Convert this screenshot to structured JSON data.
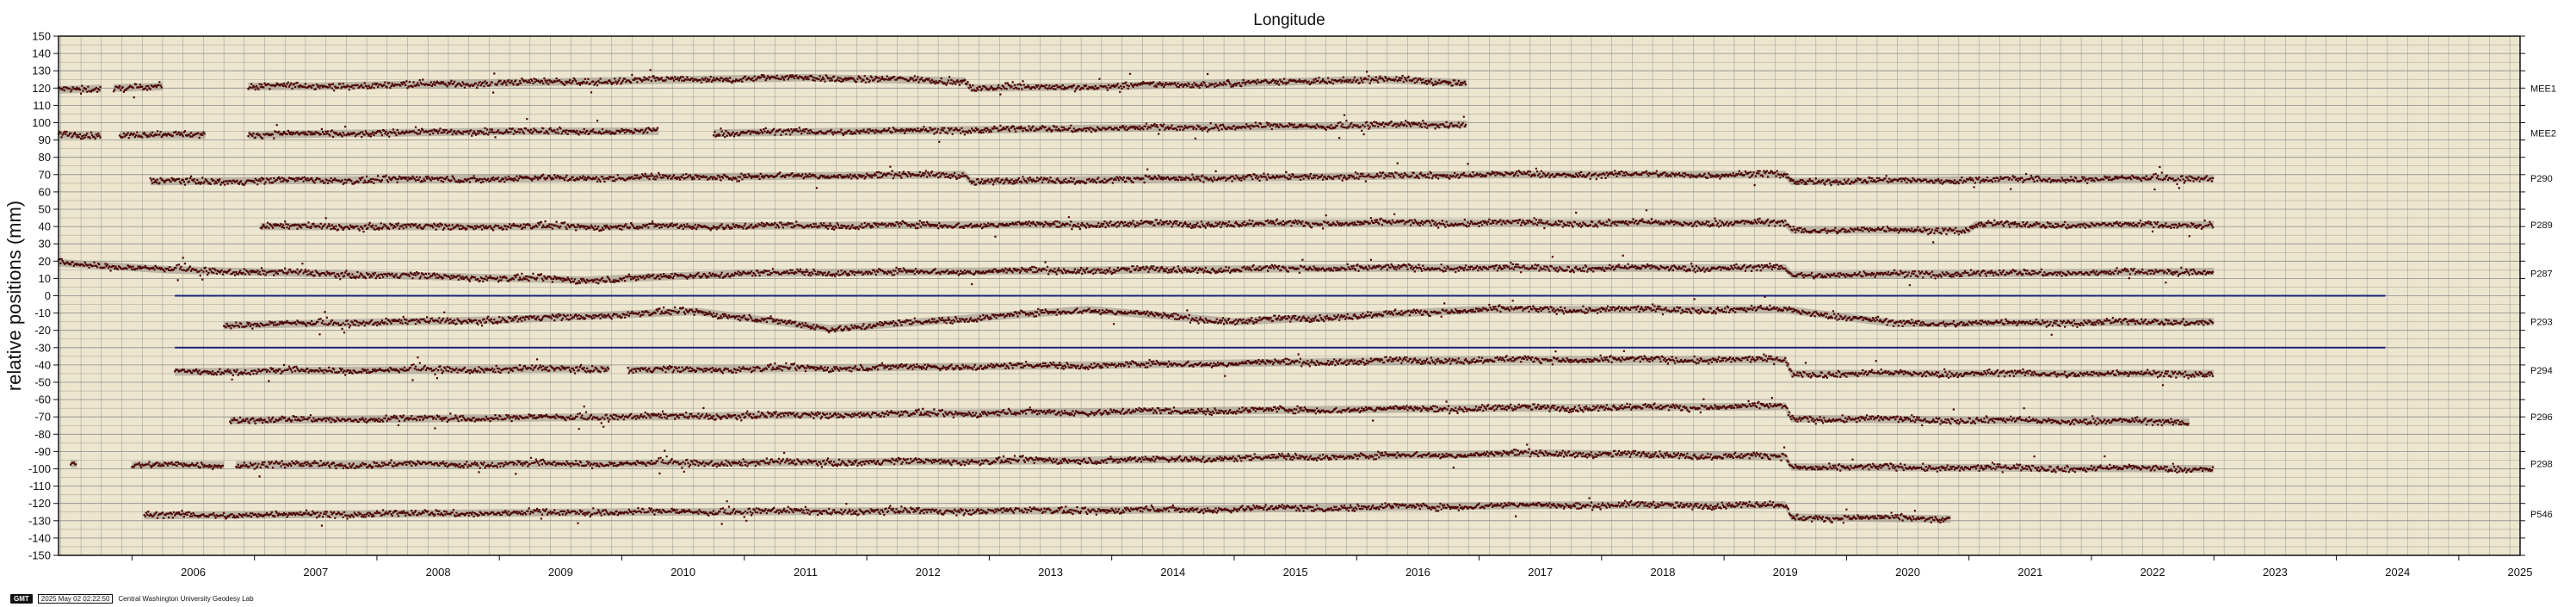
{
  "chart_data": {
    "type": "scatter",
    "title": "Longitude",
    "ylabel": "relative positions (mm)",
    "xlabel": "",
    "xlim": [
      2005.4,
      2025.5
    ],
    "ylim": [
      -150,
      150
    ],
    "grid": true,
    "x_ticks": [
      "2006",
      "2007",
      "2008",
      "2009",
      "2010",
      "2011",
      "2012",
      "2013",
      "2014",
      "2015",
      "2016",
      "2017",
      "2018",
      "2019",
      "2020",
      "2021",
      "2022",
      "2023",
      "2024",
      "2025"
    ],
    "y_ticks": [
      150,
      140,
      130,
      120,
      110,
      100,
      90,
      80,
      70,
      60,
      50,
      40,
      30,
      20,
      10,
      0,
      -10,
      -20,
      -30,
      -40,
      -50,
      -60,
      -70,
      -80,
      -90,
      -100,
      -110,
      -120,
      -130,
      -140,
      -150
    ],
    "series": [
      {
        "name": "MEE1",
        "offset": 120,
        "segments": [
          [
            2005.4,
            2005.75
          ],
          [
            2005.85,
            2006.25
          ],
          [
            2006.95,
            2016.9
          ]
        ],
        "trend": [
          [
            2005.4,
            119
          ],
          [
            2006.3,
            121
          ],
          [
            2007.5,
            121
          ],
          [
            2009,
            123
          ],
          [
            2011.5,
            126
          ],
          [
            2012.8,
            124
          ],
          [
            2012.85,
            120
          ],
          [
            2014,
            121
          ],
          [
            2016.2,
            125
          ],
          [
            2016.9,
            123
          ]
        ]
      },
      {
        "name": "MEE2",
        "offset": 94,
        "segments": [
          [
            2005.4,
            2005.75
          ],
          [
            2005.9,
            2006.6
          ],
          [
            2006.95,
            2010.3
          ],
          [
            2010.75,
            2016.9
          ]
        ],
        "trend": [
          [
            2005.4,
            93
          ],
          [
            2007,
            93
          ],
          [
            2009,
            95
          ],
          [
            2010.3,
            95
          ],
          [
            2010.75,
            94
          ],
          [
            2013,
            96
          ],
          [
            2016.9,
            99
          ]
        ]
      },
      {
        "name": "P290",
        "offset": 68,
        "segments": [
          [
            2006.15,
            2023.0
          ]
        ],
        "trend": [
          [
            2006.15,
            66
          ],
          [
            2008,
            67
          ],
          [
            2012.8,
            70
          ],
          [
            2012.85,
            66
          ],
          [
            2017,
            70
          ],
          [
            2019.5,
            70
          ],
          [
            2019.55,
            66
          ],
          [
            2023,
            68
          ]
        ]
      },
      {
        "name": "P289",
        "offset": 41,
        "segments": [
          [
            2007.05,
            2023.0
          ]
        ],
        "trend": [
          [
            2007.05,
            40
          ],
          [
            2010,
            40
          ],
          [
            2016,
            42
          ],
          [
            2019.5,
            42
          ],
          [
            2019.55,
            38
          ],
          [
            2021,
            38
          ],
          [
            2021.05,
            41
          ],
          [
            2023,
            41
          ]
        ]
      },
      {
        "name": "P287",
        "offset": 13,
        "segments": [
          [
            2005.4,
            2023.0
          ]
        ],
        "trend": [
          [
            2005.4,
            19
          ],
          [
            2006.3,
            15
          ],
          [
            2008,
            12
          ],
          [
            2009.7,
            9
          ],
          [
            2011,
            13
          ],
          [
            2016,
            16
          ],
          [
            2019.5,
            16
          ],
          [
            2019.55,
            12
          ],
          [
            2023,
            14
          ]
        ]
      },
      {
        "name": "P293",
        "offset": -15,
        "segments": [
          [
            2006.75,
            2023.0
          ]
        ],
        "trend": [
          [
            2006.75,
            -17
          ],
          [
            2009,
            -14
          ],
          [
            2010.6,
            -9
          ],
          [
            2011.7,
            -19
          ],
          [
            2013.8,
            -8
          ],
          [
            2015,
            -15
          ],
          [
            2017,
            -8
          ],
          [
            2019.5,
            -8
          ],
          [
            2020.4,
            -16
          ],
          [
            2023,
            -15
          ]
        ]
      },
      {
        "name": "P294",
        "offset": -43,
        "segments": [
          [
            2006.35,
            2009.9
          ],
          [
            2010.05,
            2023.0
          ]
        ],
        "trend": [
          [
            2006.35,
            -44
          ],
          [
            2009.9,
            -42
          ],
          [
            2010.05,
            -43
          ],
          [
            2014,
            -40
          ],
          [
            2017,
            -37
          ],
          [
            2019.5,
            -37
          ],
          [
            2019.55,
            -45
          ],
          [
            2023,
            -45
          ]
        ]
      },
      {
        "name": "P296",
        "offset": -70,
        "segments": [
          [
            2006.8,
            2022.8
          ]
        ],
        "trend": [
          [
            2006.8,
            -72
          ],
          [
            2010,
            -70
          ],
          [
            2014,
            -67
          ],
          [
            2017,
            -65
          ],
          [
            2019.5,
            -64
          ],
          [
            2019.55,
            -71
          ],
          [
            2022.8,
            -73
          ]
        ]
      },
      {
        "name": "P298",
        "offset": -97,
        "segments": [
          [
            2005.5,
            2005.55
          ],
          [
            2006.0,
            2006.75
          ],
          [
            2006.85,
            2023.0
          ]
        ],
        "trend": [
          [
            2005.5,
            -97
          ],
          [
            2006,
            -98
          ],
          [
            2010,
            -97
          ],
          [
            2014,
            -95
          ],
          [
            2017.5,
            -91
          ],
          [
            2019.5,
            -93
          ],
          [
            2019.55,
            -99
          ],
          [
            2023,
            -100
          ]
        ]
      },
      {
        "name": "P546",
        "offset": -126,
        "segments": [
          [
            2006.1,
            2020.85
          ]
        ],
        "trend": [
          [
            2006.1,
            -127
          ],
          [
            2010,
            -125
          ],
          [
            2014,
            -124
          ],
          [
            2017.5,
            -121
          ],
          [
            2019.5,
            -121
          ],
          [
            2019.55,
            -128
          ],
          [
            2020.85,
            -129
          ]
        ]
      }
    ],
    "reference_lines": [
      {
        "y": 0,
        "x_start": 2006.35,
        "x_end": 2024.4,
        "color": "#1a237e"
      },
      {
        "y": -30,
        "x_start": 2006.35,
        "x_end": 2024.4,
        "color": "#1a237e"
      }
    ]
  },
  "colors": {
    "plot_background": "#ede6cf",
    "grid": "#8a8a8a",
    "points": "#4a0505",
    "envelope": "#a89f93",
    "reference": "#1a237e"
  },
  "footer": {
    "logo": "GMT",
    "timestamp": "2025 May 02 02:22:50",
    "credit": "Central Washington University Geodesy Lab"
  }
}
